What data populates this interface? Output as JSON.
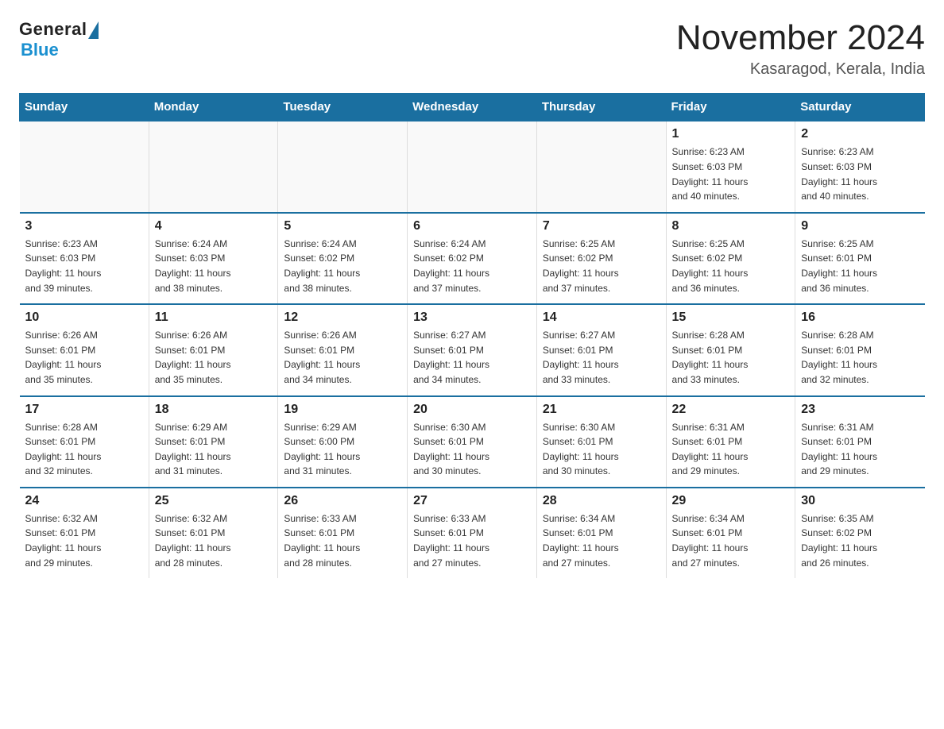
{
  "header": {
    "logo_general": "General",
    "logo_blue": "Blue",
    "title": "November 2024",
    "subtitle": "Kasaragod, Kerala, India"
  },
  "days_of_week": [
    "Sunday",
    "Monday",
    "Tuesday",
    "Wednesday",
    "Thursday",
    "Friday",
    "Saturday"
  ],
  "weeks": [
    [
      {
        "day": "",
        "info": ""
      },
      {
        "day": "",
        "info": ""
      },
      {
        "day": "",
        "info": ""
      },
      {
        "day": "",
        "info": ""
      },
      {
        "day": "",
        "info": ""
      },
      {
        "day": "1",
        "info": "Sunrise: 6:23 AM\nSunset: 6:03 PM\nDaylight: 11 hours\nand 40 minutes."
      },
      {
        "day": "2",
        "info": "Sunrise: 6:23 AM\nSunset: 6:03 PM\nDaylight: 11 hours\nand 40 minutes."
      }
    ],
    [
      {
        "day": "3",
        "info": "Sunrise: 6:23 AM\nSunset: 6:03 PM\nDaylight: 11 hours\nand 39 minutes."
      },
      {
        "day": "4",
        "info": "Sunrise: 6:24 AM\nSunset: 6:03 PM\nDaylight: 11 hours\nand 38 minutes."
      },
      {
        "day": "5",
        "info": "Sunrise: 6:24 AM\nSunset: 6:02 PM\nDaylight: 11 hours\nand 38 minutes."
      },
      {
        "day": "6",
        "info": "Sunrise: 6:24 AM\nSunset: 6:02 PM\nDaylight: 11 hours\nand 37 minutes."
      },
      {
        "day": "7",
        "info": "Sunrise: 6:25 AM\nSunset: 6:02 PM\nDaylight: 11 hours\nand 37 minutes."
      },
      {
        "day": "8",
        "info": "Sunrise: 6:25 AM\nSunset: 6:02 PM\nDaylight: 11 hours\nand 36 minutes."
      },
      {
        "day": "9",
        "info": "Sunrise: 6:25 AM\nSunset: 6:01 PM\nDaylight: 11 hours\nand 36 minutes."
      }
    ],
    [
      {
        "day": "10",
        "info": "Sunrise: 6:26 AM\nSunset: 6:01 PM\nDaylight: 11 hours\nand 35 minutes."
      },
      {
        "day": "11",
        "info": "Sunrise: 6:26 AM\nSunset: 6:01 PM\nDaylight: 11 hours\nand 35 minutes."
      },
      {
        "day": "12",
        "info": "Sunrise: 6:26 AM\nSunset: 6:01 PM\nDaylight: 11 hours\nand 34 minutes."
      },
      {
        "day": "13",
        "info": "Sunrise: 6:27 AM\nSunset: 6:01 PM\nDaylight: 11 hours\nand 34 minutes."
      },
      {
        "day": "14",
        "info": "Sunrise: 6:27 AM\nSunset: 6:01 PM\nDaylight: 11 hours\nand 33 minutes."
      },
      {
        "day": "15",
        "info": "Sunrise: 6:28 AM\nSunset: 6:01 PM\nDaylight: 11 hours\nand 33 minutes."
      },
      {
        "day": "16",
        "info": "Sunrise: 6:28 AM\nSunset: 6:01 PM\nDaylight: 11 hours\nand 32 minutes."
      }
    ],
    [
      {
        "day": "17",
        "info": "Sunrise: 6:28 AM\nSunset: 6:01 PM\nDaylight: 11 hours\nand 32 minutes."
      },
      {
        "day": "18",
        "info": "Sunrise: 6:29 AM\nSunset: 6:01 PM\nDaylight: 11 hours\nand 31 minutes."
      },
      {
        "day": "19",
        "info": "Sunrise: 6:29 AM\nSunset: 6:00 PM\nDaylight: 11 hours\nand 31 minutes."
      },
      {
        "day": "20",
        "info": "Sunrise: 6:30 AM\nSunset: 6:01 PM\nDaylight: 11 hours\nand 30 minutes."
      },
      {
        "day": "21",
        "info": "Sunrise: 6:30 AM\nSunset: 6:01 PM\nDaylight: 11 hours\nand 30 minutes."
      },
      {
        "day": "22",
        "info": "Sunrise: 6:31 AM\nSunset: 6:01 PM\nDaylight: 11 hours\nand 29 minutes."
      },
      {
        "day": "23",
        "info": "Sunrise: 6:31 AM\nSunset: 6:01 PM\nDaylight: 11 hours\nand 29 minutes."
      }
    ],
    [
      {
        "day": "24",
        "info": "Sunrise: 6:32 AM\nSunset: 6:01 PM\nDaylight: 11 hours\nand 29 minutes."
      },
      {
        "day": "25",
        "info": "Sunrise: 6:32 AM\nSunset: 6:01 PM\nDaylight: 11 hours\nand 28 minutes."
      },
      {
        "day": "26",
        "info": "Sunrise: 6:33 AM\nSunset: 6:01 PM\nDaylight: 11 hours\nand 28 minutes."
      },
      {
        "day": "27",
        "info": "Sunrise: 6:33 AM\nSunset: 6:01 PM\nDaylight: 11 hours\nand 27 minutes."
      },
      {
        "day": "28",
        "info": "Sunrise: 6:34 AM\nSunset: 6:01 PM\nDaylight: 11 hours\nand 27 minutes."
      },
      {
        "day": "29",
        "info": "Sunrise: 6:34 AM\nSunset: 6:01 PM\nDaylight: 11 hours\nand 27 minutes."
      },
      {
        "day": "30",
        "info": "Sunrise: 6:35 AM\nSunset: 6:02 PM\nDaylight: 11 hours\nand 26 minutes."
      }
    ]
  ]
}
